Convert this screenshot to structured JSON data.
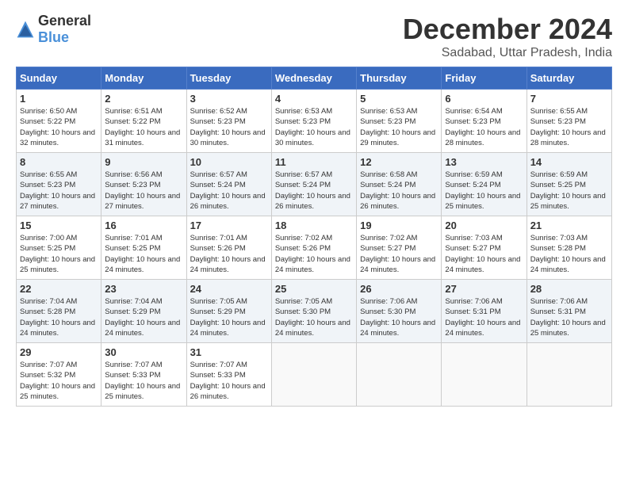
{
  "logo": {
    "general": "General",
    "blue": "Blue"
  },
  "title": "December 2024",
  "subtitle": "Sadabad, Uttar Pradesh, India",
  "days_of_week": [
    "Sunday",
    "Monday",
    "Tuesday",
    "Wednesday",
    "Thursday",
    "Friday",
    "Saturday"
  ],
  "weeks": [
    [
      {
        "day": "1",
        "sunrise": "6:50 AM",
        "sunset": "5:22 PM",
        "daylight": "10 hours and 32 minutes."
      },
      {
        "day": "2",
        "sunrise": "6:51 AM",
        "sunset": "5:22 PM",
        "daylight": "10 hours and 31 minutes."
      },
      {
        "day": "3",
        "sunrise": "6:52 AM",
        "sunset": "5:23 PM",
        "daylight": "10 hours and 30 minutes."
      },
      {
        "day": "4",
        "sunrise": "6:53 AM",
        "sunset": "5:23 PM",
        "daylight": "10 hours and 30 minutes."
      },
      {
        "day": "5",
        "sunrise": "6:53 AM",
        "sunset": "5:23 PM",
        "daylight": "10 hours and 29 minutes."
      },
      {
        "day": "6",
        "sunrise": "6:54 AM",
        "sunset": "5:23 PM",
        "daylight": "10 hours and 28 minutes."
      },
      {
        "day": "7",
        "sunrise": "6:55 AM",
        "sunset": "5:23 PM",
        "daylight": "10 hours and 28 minutes."
      }
    ],
    [
      {
        "day": "8",
        "sunrise": "6:55 AM",
        "sunset": "5:23 PM",
        "daylight": "10 hours and 27 minutes."
      },
      {
        "day": "9",
        "sunrise": "6:56 AM",
        "sunset": "5:23 PM",
        "daylight": "10 hours and 27 minutes."
      },
      {
        "day": "10",
        "sunrise": "6:57 AM",
        "sunset": "5:24 PM",
        "daylight": "10 hours and 26 minutes."
      },
      {
        "day": "11",
        "sunrise": "6:57 AM",
        "sunset": "5:24 PM",
        "daylight": "10 hours and 26 minutes."
      },
      {
        "day": "12",
        "sunrise": "6:58 AM",
        "sunset": "5:24 PM",
        "daylight": "10 hours and 26 minutes."
      },
      {
        "day": "13",
        "sunrise": "6:59 AM",
        "sunset": "5:24 PM",
        "daylight": "10 hours and 25 minutes."
      },
      {
        "day": "14",
        "sunrise": "6:59 AM",
        "sunset": "5:25 PM",
        "daylight": "10 hours and 25 minutes."
      }
    ],
    [
      {
        "day": "15",
        "sunrise": "7:00 AM",
        "sunset": "5:25 PM",
        "daylight": "10 hours and 25 minutes."
      },
      {
        "day": "16",
        "sunrise": "7:01 AM",
        "sunset": "5:25 PM",
        "daylight": "10 hours and 24 minutes."
      },
      {
        "day": "17",
        "sunrise": "7:01 AM",
        "sunset": "5:26 PM",
        "daylight": "10 hours and 24 minutes."
      },
      {
        "day": "18",
        "sunrise": "7:02 AM",
        "sunset": "5:26 PM",
        "daylight": "10 hours and 24 minutes."
      },
      {
        "day": "19",
        "sunrise": "7:02 AM",
        "sunset": "5:27 PM",
        "daylight": "10 hours and 24 minutes."
      },
      {
        "day": "20",
        "sunrise": "7:03 AM",
        "sunset": "5:27 PM",
        "daylight": "10 hours and 24 minutes."
      },
      {
        "day": "21",
        "sunrise": "7:03 AM",
        "sunset": "5:28 PM",
        "daylight": "10 hours and 24 minutes."
      }
    ],
    [
      {
        "day": "22",
        "sunrise": "7:04 AM",
        "sunset": "5:28 PM",
        "daylight": "10 hours and 24 minutes."
      },
      {
        "day": "23",
        "sunrise": "7:04 AM",
        "sunset": "5:29 PM",
        "daylight": "10 hours and 24 minutes."
      },
      {
        "day": "24",
        "sunrise": "7:05 AM",
        "sunset": "5:29 PM",
        "daylight": "10 hours and 24 minutes."
      },
      {
        "day": "25",
        "sunrise": "7:05 AM",
        "sunset": "5:30 PM",
        "daylight": "10 hours and 24 minutes."
      },
      {
        "day": "26",
        "sunrise": "7:06 AM",
        "sunset": "5:30 PM",
        "daylight": "10 hours and 24 minutes."
      },
      {
        "day": "27",
        "sunrise": "7:06 AM",
        "sunset": "5:31 PM",
        "daylight": "10 hours and 24 minutes."
      },
      {
        "day": "28",
        "sunrise": "7:06 AM",
        "sunset": "5:31 PM",
        "daylight": "10 hours and 25 minutes."
      }
    ],
    [
      {
        "day": "29",
        "sunrise": "7:07 AM",
        "sunset": "5:32 PM",
        "daylight": "10 hours and 25 minutes."
      },
      {
        "day": "30",
        "sunrise": "7:07 AM",
        "sunset": "5:33 PM",
        "daylight": "10 hours and 25 minutes."
      },
      {
        "day": "31",
        "sunrise": "7:07 AM",
        "sunset": "5:33 PM",
        "daylight": "10 hours and 26 minutes."
      },
      null,
      null,
      null,
      null
    ]
  ]
}
